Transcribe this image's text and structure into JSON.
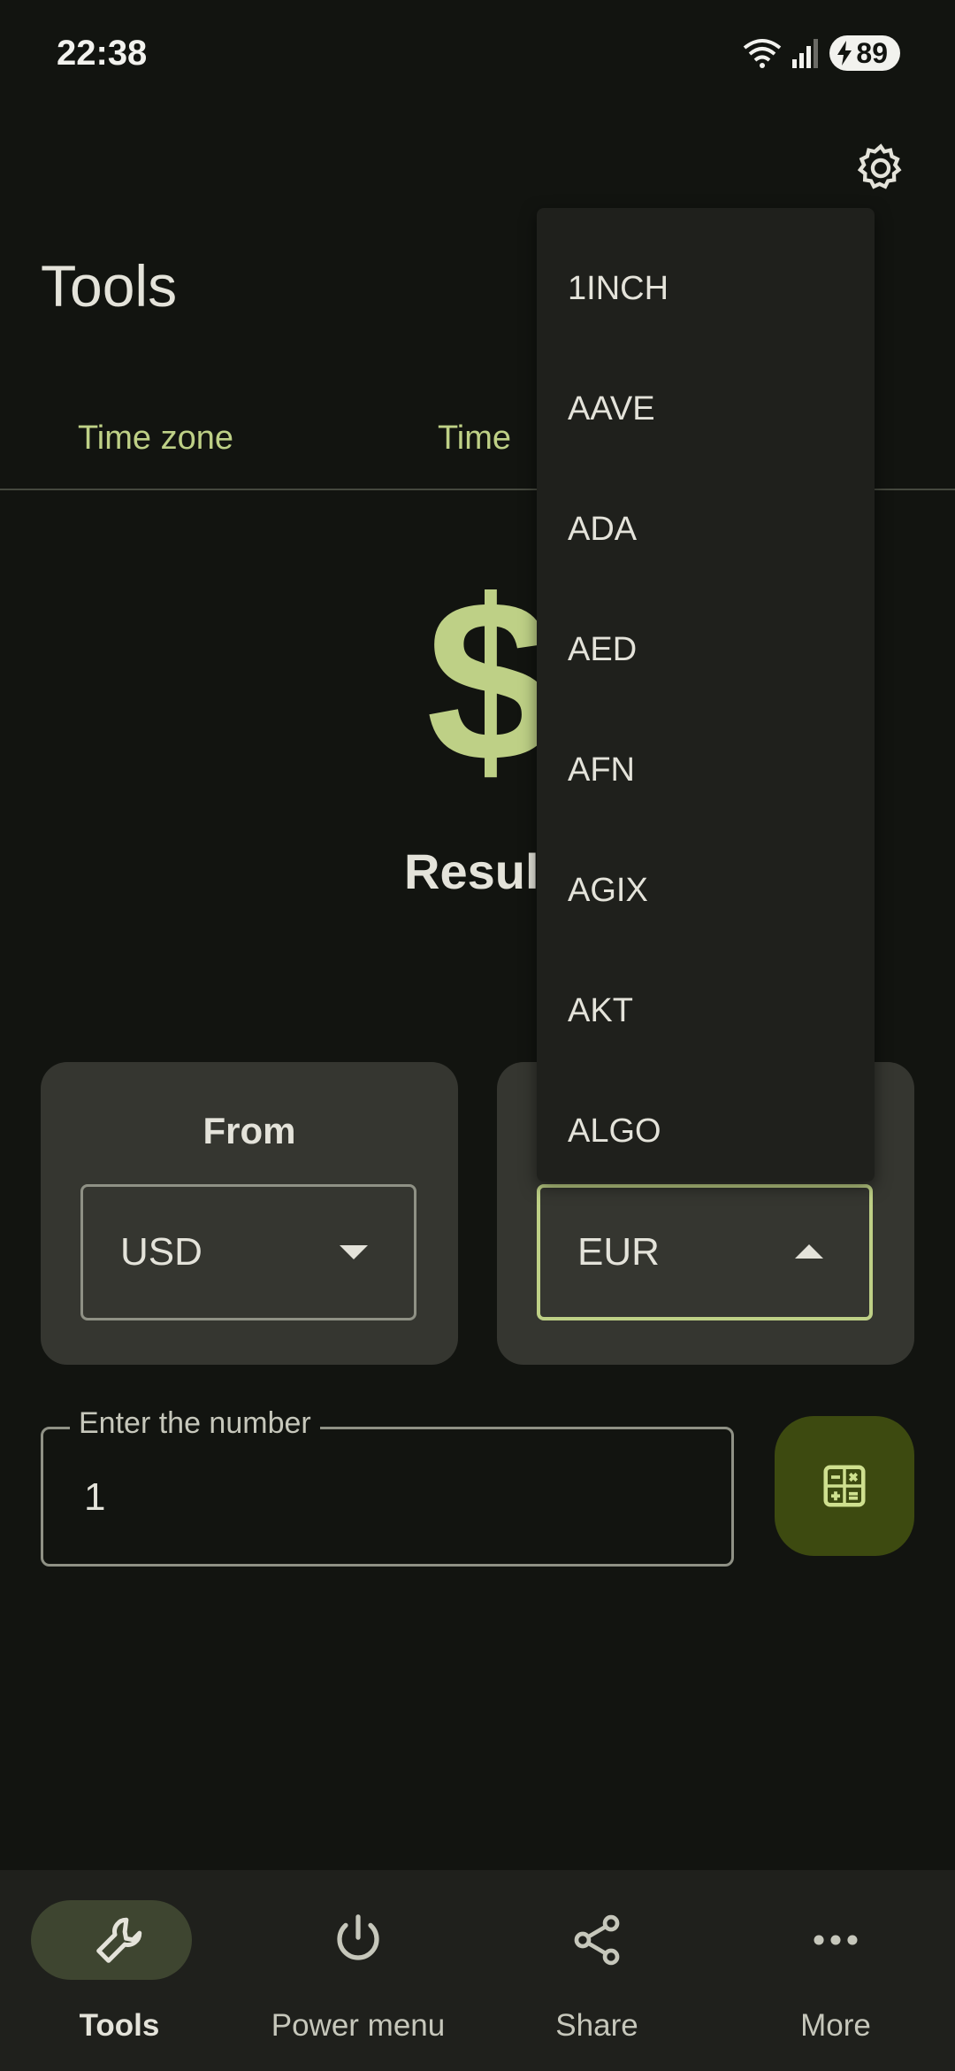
{
  "status": {
    "time": "22:38",
    "battery": "89"
  },
  "header": {
    "title": "Tools",
    "settings_icon": "gear-icon"
  },
  "tabs": [
    {
      "label": "Time zone"
    },
    {
      "label": "Time"
    }
  ],
  "converter": {
    "symbol": "$",
    "result_label": "Result",
    "from": {
      "label": "From",
      "value": "USD"
    },
    "to": {
      "value": "EUR"
    },
    "number_field": {
      "label": "Enter the number",
      "value": "1"
    },
    "calc_icon": "calculator-icon"
  },
  "dropdown": {
    "items": [
      "1INCH",
      "AAVE",
      "ADA",
      "AED",
      "AFN",
      "AGIX",
      "AKT",
      "ALGO"
    ]
  },
  "bottom_nav": [
    {
      "label": "Tools",
      "icon": "wrench-icon",
      "selected": true
    },
    {
      "label": "Power menu",
      "icon": "power-icon"
    },
    {
      "label": "Share",
      "icon": "share-icon"
    },
    {
      "label": "More",
      "icon": "more-icon"
    }
  ],
  "colors": {
    "accent": "#bed086",
    "background": "#121410",
    "surface": "#353630",
    "menu": "#1f201c",
    "calc_button": "#3d4a10"
  }
}
